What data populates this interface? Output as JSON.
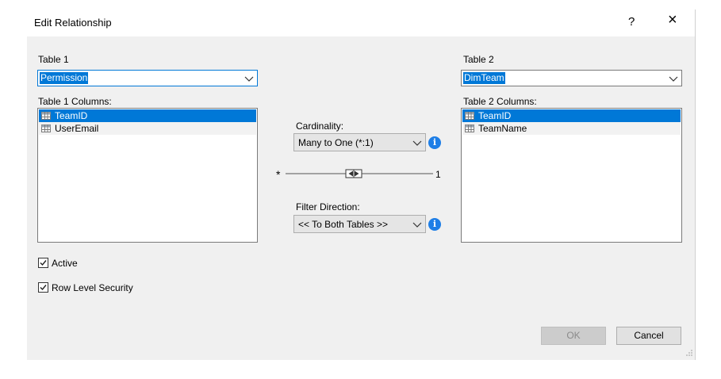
{
  "dialog": {
    "title": "Edit Relationship",
    "help": "?",
    "close": "×"
  },
  "table1": {
    "label": "Table 1",
    "selected": "Permission",
    "columns_label": "Table 1 Columns:",
    "columns": [
      "TeamID",
      "UserEmail"
    ]
  },
  "table2": {
    "label": "Table 2",
    "selected": "DimTeam",
    "columns_label": "Table 2 Columns:",
    "columns": [
      "TeamID",
      "TeamName"
    ]
  },
  "cardinality": {
    "label": "Cardinality:",
    "value": "Many to One (*:1)",
    "left_marker": "*",
    "right_marker": "1"
  },
  "filter": {
    "label": "Filter Direction:",
    "value": "<< To Both Tables >>"
  },
  "options": {
    "active": {
      "label": "Active",
      "checked": true
    },
    "rls": {
      "label": "Row Level Security",
      "checked": true
    }
  },
  "buttons": {
    "ok": "OK",
    "cancel": "Cancel"
  },
  "info_glyph": "i",
  "colors": {
    "selection": "#0078d7",
    "info": "#1e7ee6",
    "client_bg": "#f0f0f0"
  }
}
